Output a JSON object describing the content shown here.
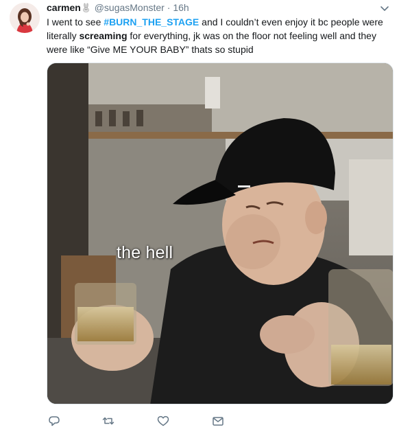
{
  "tweet": {
    "display_name": "carmen",
    "name_emoji": "rabbit-emoji",
    "handle": "@sugasMonster",
    "separator": "·",
    "time": "16h",
    "text_segments": [
      {
        "text": "I went to see ",
        "style": "normal"
      },
      {
        "text": "#BURN_THE_STAGE",
        "style": "hashtag"
      },
      {
        "text": " and I couldn’t even enjoy it bc people were literally ",
        "style": "normal"
      },
      {
        "text": "screaming",
        "style": "bold"
      },
      {
        "text": " for everything, jk was on the floor not feeling well and they were like “Give ME YOUR BABY” thats so stupid",
        "style": "normal"
      }
    ],
    "media": {
      "caption": "the hell"
    },
    "actions": [
      {
        "name": "reply",
        "icon": "reply-icon"
      },
      {
        "name": "retweet",
        "icon": "retweet-icon"
      },
      {
        "name": "like",
        "icon": "heart-icon"
      },
      {
        "name": "direct-message",
        "icon": "envelope-icon"
      }
    ]
  },
  "colors": {
    "hashtag": "#1da1f2",
    "secondary_text": "#657786",
    "primary_text": "#14171a",
    "icon": "#657786"
  }
}
